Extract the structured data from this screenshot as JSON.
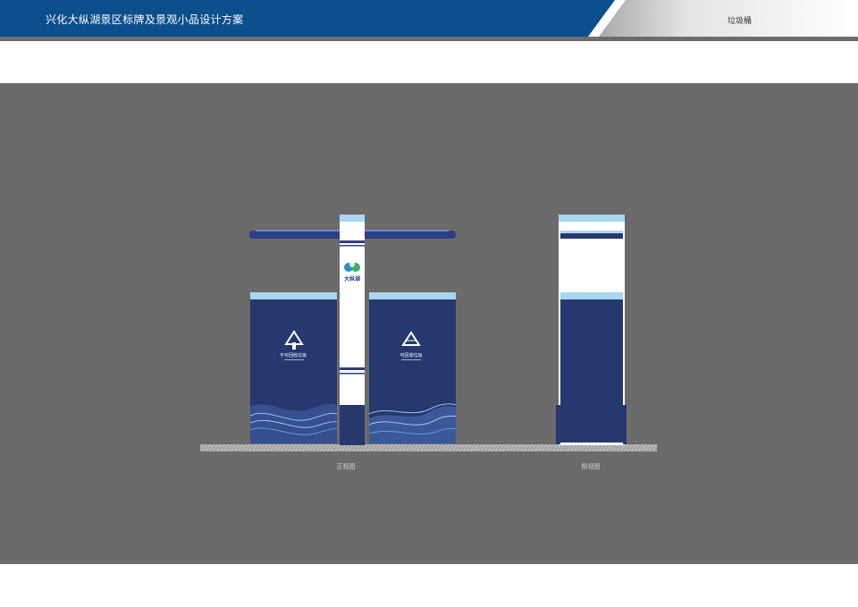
{
  "header": {
    "title": "兴化大纵湖景区标牌及景观小品设计方案",
    "section": "垃圾桶"
  },
  "drawing": {
    "front": {
      "logo_text": "大纵湖",
      "left_bin_label": "不可回收垃圾",
      "right_bin_label": "可回收垃圾",
      "view_label": "正视图"
    },
    "side": {
      "view_label": "侧视图"
    }
  },
  "colors": {
    "header_blue": "#0b4f8d",
    "bin_navy": "#26386e",
    "top_light_blue": "#a9d6f0",
    "panel_grey": "#6b6b6b"
  }
}
